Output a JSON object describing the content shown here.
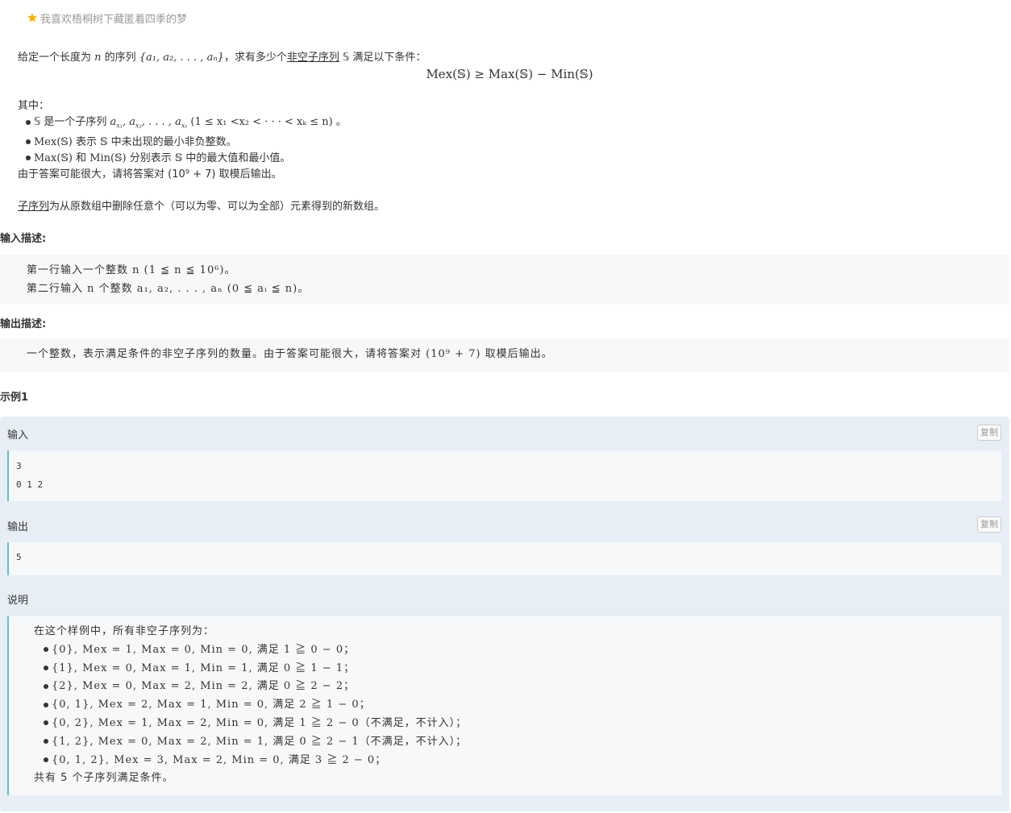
{
  "header": {
    "title": "我喜欢梧桐树下藏匿着四季的梦",
    "star_color": "#f5b400"
  },
  "statement": {
    "intro_1": "给定一个长度为 ",
    "intro_n": "n",
    "intro_2": " 的序列 ",
    "intro_seq": "{a₁, a₂, . . . , aₙ}",
    "intro_3": "，求有多少个",
    "intro_nonempty": "非空",
    "intro_subseq": "子序列",
    "intro_4": " 𝕊 满足以下条件：",
    "formula": "Mex(𝕊) ≥ Max(𝕊) − Min(𝕊)",
    "where": "其中：",
    "b1_a": "𝕊 是一个子序列 ",
    "b1_seq": "a",
    "b1_b": "(1 ≤ x₁ <x₂ < · · · < xₖ ≤ n) 。",
    "b2": "Mex(𝕊) 表示 𝕊 中未出现的最小非负整数。",
    "b3": "Max(𝕊) 和 Min(𝕊) 分别表示 𝕊 中的最大值和最小值。",
    "mod_note": "由于答案可能很大，请将答案对 (10⁹ + 7) 取模后输出。",
    "def_term": "子序列",
    "def_text": "为从原数组中删除任意个（可以为零、可以为全部）元素得到的新数组。"
  },
  "input_section": {
    "heading": "输入描述:",
    "line1": "第一行输入一个整数 n (1 ≦ n ≦ 10⁶)。",
    "line2": "第二行输入 n 个整数 a₁, a₂, . . . , aₙ (0 ≦ aᵢ ≦ n)。"
  },
  "output_section": {
    "heading": "输出描述:",
    "line1": "一个整数，表示满足条件的非空子序列的数量。由于答案可能很大，请将答案对 (10⁹ + 7) 取模后输出。"
  },
  "example": {
    "heading": "示例1",
    "input_label": "输入",
    "output_label": "输出",
    "explain_label": "说明",
    "copy_label": "复制",
    "input_lines": [
      "3",
      "0 1 2"
    ],
    "output_lines": [
      "5"
    ],
    "explain_intro": "在这个样例中，所有非空子序列为：",
    "explain_items": [
      "{0}, Mex = 1, Max = 0, Min = 0, 满足 1 ≧ 0 − 0；",
      "{1}, Mex = 0, Max = 1, Min = 1, 满足 0 ≧ 1 − 1；",
      "{2}, Mex = 0, Max = 2, Min = 2, 满足 0 ≧ 2 − 2；",
      "{0, 1}, Mex = 2, Max = 1, Min = 0, 满足 2 ≧ 1 − 0；",
      "{0, 2}, Mex = 1, Max = 2, Min = 0, 满足 1 ≧ 2 − 0（不满足，不计入）；",
      "{1, 2}, Mex = 0, Max = 2, Min = 1, 满足 0 ≧ 2 − 1（不满足，不计入）；",
      "{0, 1, 2}, Mex = 3, Max = 2, Min = 0, 满足 3 ≧ 2 − 0；"
    ],
    "explain_outro": "共有 5 个子序列满足条件。"
  }
}
